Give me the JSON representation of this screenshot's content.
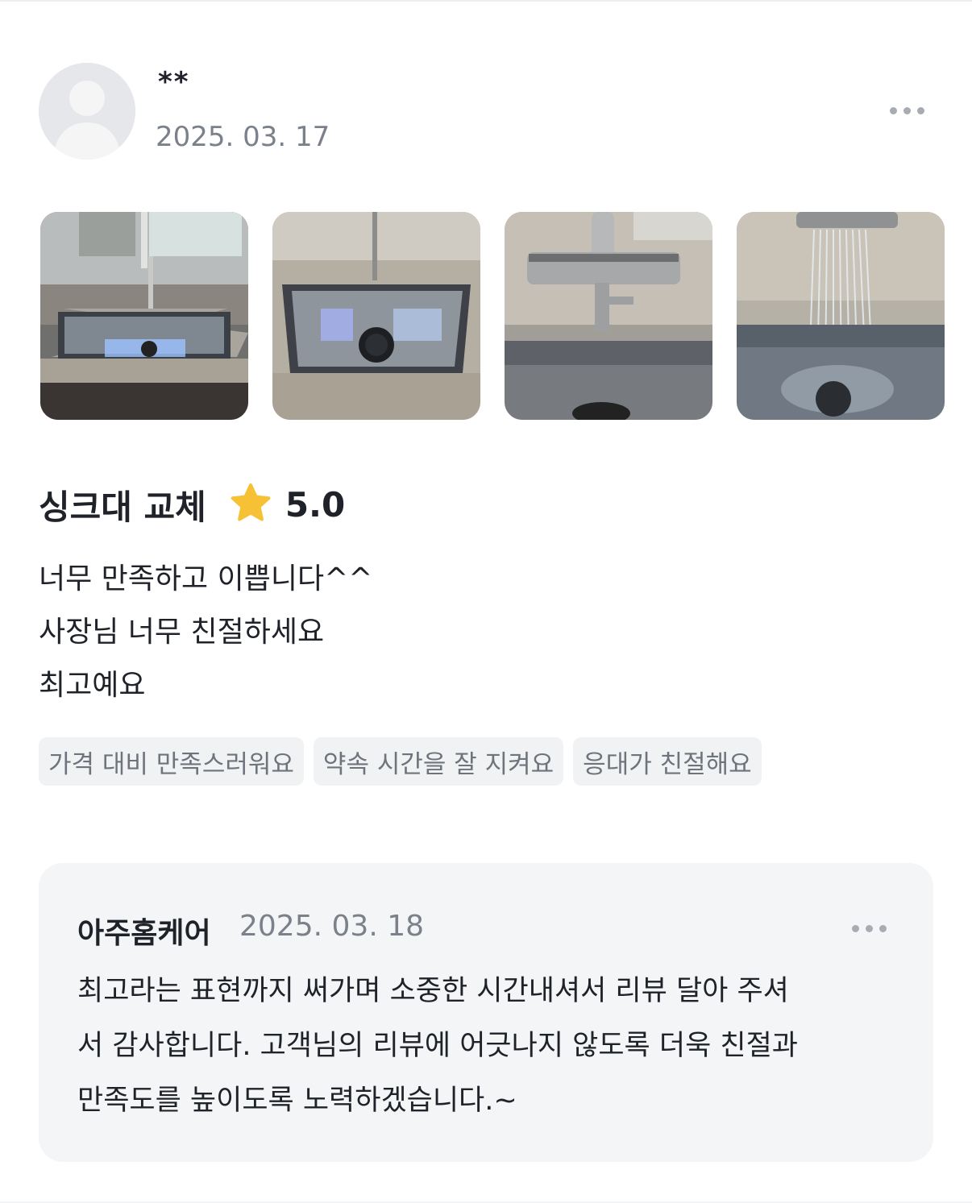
{
  "review": {
    "author_name": "**",
    "date": "2025. 03. 17",
    "more_icon": "more-horizontal-icon",
    "photos": [
      {
        "description": "sink-photo-with-window"
      },
      {
        "description": "sink-photo-drain"
      },
      {
        "description": "faucet-photo"
      },
      {
        "description": "faucet-waterfall-photo"
      }
    ],
    "service_name": "싱크대 교체",
    "rating_icon": "star-icon",
    "rating": "5.0",
    "body_lines": [
      "너무 만족하고 이쁩니다^^",
      "사장님 너무 친절하세요",
      "최고예요"
    ],
    "tags": [
      "가격 대비 만족스러워요",
      "약속 시간을 잘 지켜요",
      "응대가 친절해요"
    ]
  },
  "reply": {
    "owner_name": "아주홈케어",
    "date": "2025. 03. 18",
    "lines": [
      "최고라는 표현까지 써가며 소중한 시간내셔서 리뷰 달아 주셔",
      "서 감사합니다. 고객님의 리뷰에 어긋나지 않도록 더욱 친절과",
      "만족도를 높이도록 노력하겠습니다.~"
    ]
  },
  "colors": {
    "text_primary": "#1f2329",
    "text_secondary": "#7b818a",
    "tag_bg": "#f1f2f4",
    "reply_bg": "#f4f5f7",
    "star": "#f7c136"
  }
}
